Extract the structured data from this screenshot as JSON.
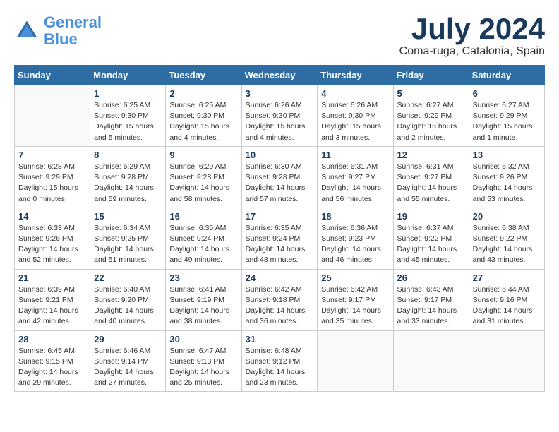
{
  "logo": {
    "text_general": "General",
    "text_blue": "Blue"
  },
  "title": "July 2024",
  "location": "Coma-ruga, Catalonia, Spain",
  "weekdays": [
    "Sunday",
    "Monday",
    "Tuesday",
    "Wednesday",
    "Thursday",
    "Friday",
    "Saturday"
  ],
  "weeks": [
    [
      {
        "day": "",
        "info": ""
      },
      {
        "day": "1",
        "info": "Sunrise: 6:25 AM\nSunset: 9:30 PM\nDaylight: 15 hours\nand 5 minutes."
      },
      {
        "day": "2",
        "info": "Sunrise: 6:25 AM\nSunset: 9:30 PM\nDaylight: 15 hours\nand 4 minutes."
      },
      {
        "day": "3",
        "info": "Sunrise: 6:26 AM\nSunset: 9:30 PM\nDaylight: 15 hours\nand 4 minutes."
      },
      {
        "day": "4",
        "info": "Sunrise: 6:26 AM\nSunset: 9:30 PM\nDaylight: 15 hours\nand 3 minutes."
      },
      {
        "day": "5",
        "info": "Sunrise: 6:27 AM\nSunset: 9:29 PM\nDaylight: 15 hours\nand 2 minutes."
      },
      {
        "day": "6",
        "info": "Sunrise: 6:27 AM\nSunset: 9:29 PM\nDaylight: 15 hours\nand 1 minute."
      }
    ],
    [
      {
        "day": "7",
        "info": "Sunrise: 6:28 AM\nSunset: 9:29 PM\nDaylight: 15 hours\nand 0 minutes."
      },
      {
        "day": "8",
        "info": "Sunrise: 6:29 AM\nSunset: 9:28 PM\nDaylight: 14 hours\nand 59 minutes."
      },
      {
        "day": "9",
        "info": "Sunrise: 6:29 AM\nSunset: 9:28 PM\nDaylight: 14 hours\nand 58 minutes."
      },
      {
        "day": "10",
        "info": "Sunrise: 6:30 AM\nSunset: 9:28 PM\nDaylight: 14 hours\nand 57 minutes."
      },
      {
        "day": "11",
        "info": "Sunrise: 6:31 AM\nSunset: 9:27 PM\nDaylight: 14 hours\nand 56 minutes."
      },
      {
        "day": "12",
        "info": "Sunrise: 6:31 AM\nSunset: 9:27 PM\nDaylight: 14 hours\nand 55 minutes."
      },
      {
        "day": "13",
        "info": "Sunrise: 6:32 AM\nSunset: 9:26 PM\nDaylight: 14 hours\nand 53 minutes."
      }
    ],
    [
      {
        "day": "14",
        "info": "Sunrise: 6:33 AM\nSunset: 9:26 PM\nDaylight: 14 hours\nand 52 minutes."
      },
      {
        "day": "15",
        "info": "Sunrise: 6:34 AM\nSunset: 9:25 PM\nDaylight: 14 hours\nand 51 minutes."
      },
      {
        "day": "16",
        "info": "Sunrise: 6:35 AM\nSunset: 9:24 PM\nDaylight: 14 hours\nand 49 minutes."
      },
      {
        "day": "17",
        "info": "Sunrise: 6:35 AM\nSunset: 9:24 PM\nDaylight: 14 hours\nand 48 minutes."
      },
      {
        "day": "18",
        "info": "Sunrise: 6:36 AM\nSunset: 9:23 PM\nDaylight: 14 hours\nand 46 minutes."
      },
      {
        "day": "19",
        "info": "Sunrise: 6:37 AM\nSunset: 9:22 PM\nDaylight: 14 hours\nand 45 minutes."
      },
      {
        "day": "20",
        "info": "Sunrise: 6:38 AM\nSunset: 9:22 PM\nDaylight: 14 hours\nand 43 minutes."
      }
    ],
    [
      {
        "day": "21",
        "info": "Sunrise: 6:39 AM\nSunset: 9:21 PM\nDaylight: 14 hours\nand 42 minutes."
      },
      {
        "day": "22",
        "info": "Sunrise: 6:40 AM\nSunset: 9:20 PM\nDaylight: 14 hours\nand 40 minutes."
      },
      {
        "day": "23",
        "info": "Sunrise: 6:41 AM\nSunset: 9:19 PM\nDaylight: 14 hours\nand 38 minutes."
      },
      {
        "day": "24",
        "info": "Sunrise: 6:42 AM\nSunset: 9:18 PM\nDaylight: 14 hours\nand 36 minutes."
      },
      {
        "day": "25",
        "info": "Sunrise: 6:42 AM\nSunset: 9:17 PM\nDaylight: 14 hours\nand 35 minutes."
      },
      {
        "day": "26",
        "info": "Sunrise: 6:43 AM\nSunset: 9:17 PM\nDaylight: 14 hours\nand 33 minutes."
      },
      {
        "day": "27",
        "info": "Sunrise: 6:44 AM\nSunset: 9:16 PM\nDaylight: 14 hours\nand 31 minutes."
      }
    ],
    [
      {
        "day": "28",
        "info": "Sunrise: 6:45 AM\nSunset: 9:15 PM\nDaylight: 14 hours\nand 29 minutes."
      },
      {
        "day": "29",
        "info": "Sunrise: 6:46 AM\nSunset: 9:14 PM\nDaylight: 14 hours\nand 27 minutes."
      },
      {
        "day": "30",
        "info": "Sunrise: 6:47 AM\nSunset: 9:13 PM\nDaylight: 14 hours\nand 25 minutes."
      },
      {
        "day": "31",
        "info": "Sunrise: 6:48 AM\nSunset: 9:12 PM\nDaylight: 14 hours\nand 23 minutes."
      },
      {
        "day": "",
        "info": ""
      },
      {
        "day": "",
        "info": ""
      },
      {
        "day": "",
        "info": ""
      }
    ]
  ]
}
